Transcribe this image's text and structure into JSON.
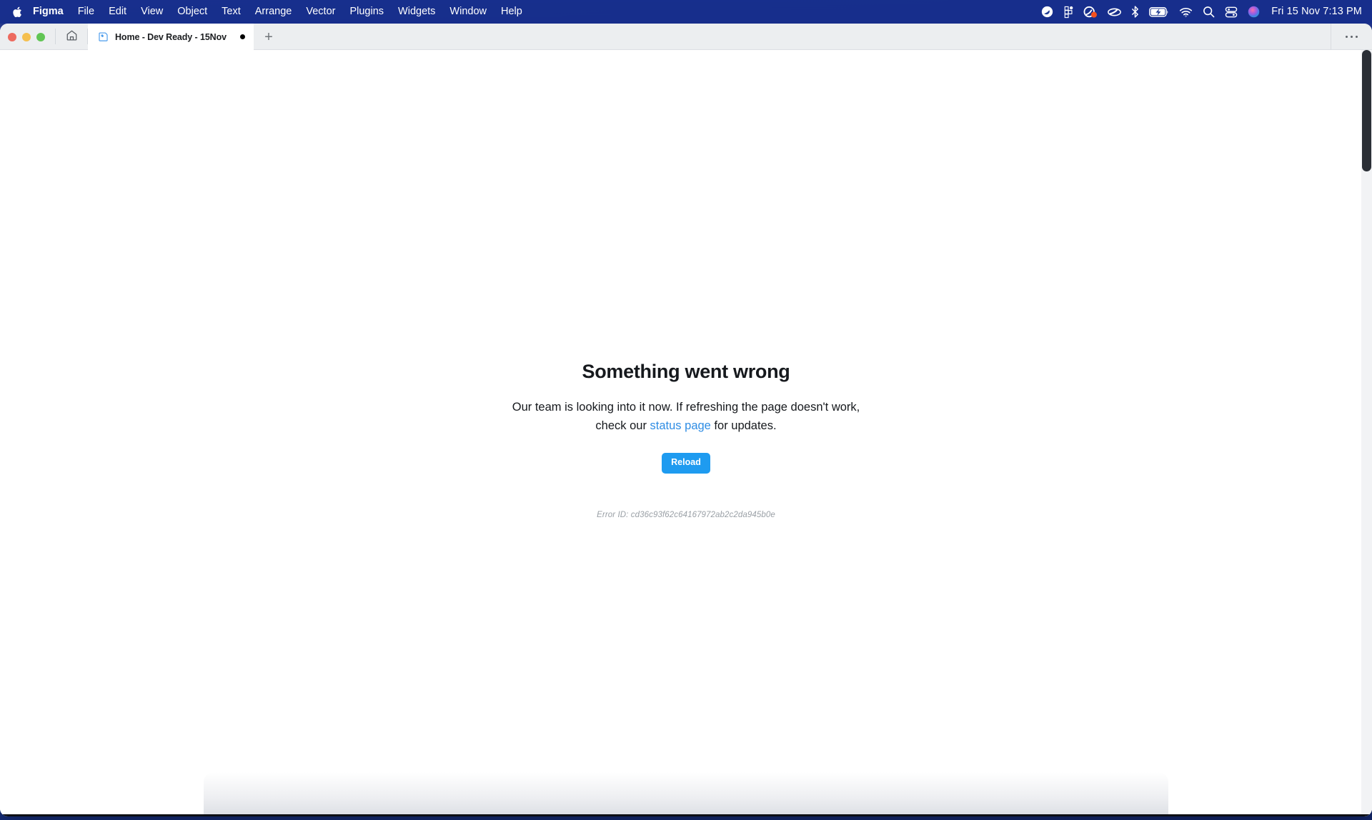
{
  "menubar": {
    "apple_icon": "apple-logo-icon",
    "items": [
      {
        "label": "Figma",
        "bold": true
      },
      {
        "label": "File",
        "bold": false
      },
      {
        "label": "Edit",
        "bold": false
      },
      {
        "label": "View",
        "bold": false
      },
      {
        "label": "Object",
        "bold": false
      },
      {
        "label": "Text",
        "bold": false
      },
      {
        "label": "Arrange",
        "bold": false
      },
      {
        "label": "Vector",
        "bold": false
      },
      {
        "label": "Plugins",
        "bold": false
      },
      {
        "label": "Widgets",
        "bold": false
      },
      {
        "label": "Window",
        "bold": false
      },
      {
        "label": "Help",
        "bold": false
      }
    ],
    "status_icons": [
      "grammarly-icon",
      "figma-menu-icon",
      "notification-badge-icon",
      "cloud-sync-icon",
      "bluetooth-icon",
      "battery-charging-icon",
      "wifi-icon",
      "spotlight-search-icon",
      "control-center-icon",
      "siri-icon"
    ],
    "clock": "Fri 15 Nov  7:13 PM"
  },
  "window": {
    "traffic_lights": [
      "close",
      "minimize",
      "zoom"
    ],
    "home_button_icon": "home-icon",
    "tabs": [
      {
        "title": "Home - Dev Ready - 15Nov",
        "icon": "figma-file-icon",
        "dirty": true,
        "active": true
      }
    ],
    "new_tab_label": "+",
    "more_options_icon": "ellipsis-icon"
  },
  "error_page": {
    "title": "Something went wrong",
    "description_before_link": "Our team is looking into it now. If refreshing the page doesn't work, check our ",
    "link_text": "status page",
    "description_after_link": " for updates.",
    "reload_label": "Reload",
    "error_id": "Error ID: cd36c93f62c64167972ab2c2da945b0e",
    "link_color": "#2f8de4",
    "button_color": "#1e9bf0"
  }
}
